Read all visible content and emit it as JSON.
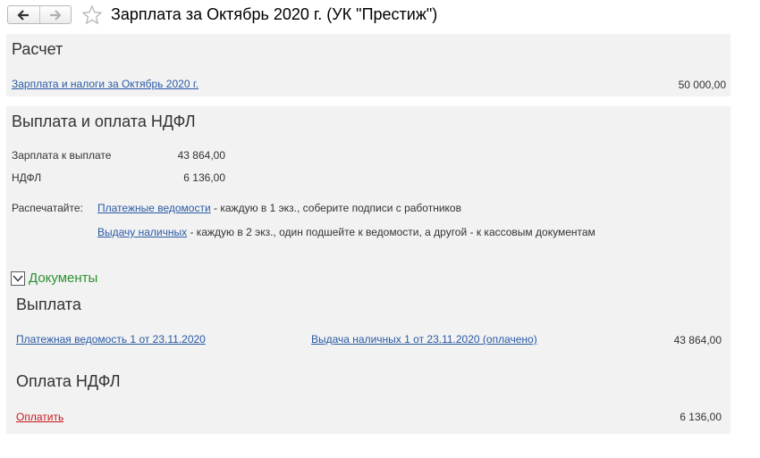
{
  "window": {
    "title": "Зарплата за Октябрь 2020 г. (УК \"Престиж\")",
    "icons": {
      "back": "arrow-left-icon",
      "forward": "arrow-right-icon",
      "favorite": "star-icon"
    }
  },
  "calc": {
    "heading": "Расчет",
    "link_label": "Зарплата и налоги за Октябрь 2020 г.",
    "amount": "50 000,00"
  },
  "payment": {
    "heading": "Выплата и оплата НДФЛ",
    "salary_label": "Зарплата к выплате",
    "salary_value": "43 864,00",
    "ndfl_label": "НДФЛ",
    "ndfl_value": "6 136,00",
    "print_label": "Распечатайте:",
    "print_link_1": "Платежные ведомости",
    "print_note_1": " - каждую в 1 экз., соберите подписи с работников",
    "print_link_2": "Выдачу наличных",
    "print_note_2": " - каждую в 2 экз., один подшейте к ведомости, а другой - к кассовым документам"
  },
  "documents": {
    "toggle_label": "Документы",
    "payout": {
      "heading": "Выплата",
      "doc_link_1": "Платежная ведомость 1 от 23.11.2020",
      "doc_link_2": "Выдача наличных 1 от 23.11.2020 (оплачено)",
      "amount": "43 864,00"
    },
    "ndfl_payment": {
      "heading": "Оплата НДФЛ",
      "pay_link": "Оплатить",
      "amount": "6 136,00"
    }
  },
  "colors": {
    "link": "#2a5aa5",
    "link_red": "#c9161c",
    "group_green": "#2b9130",
    "panel_bg": "#f2f2f2"
  }
}
